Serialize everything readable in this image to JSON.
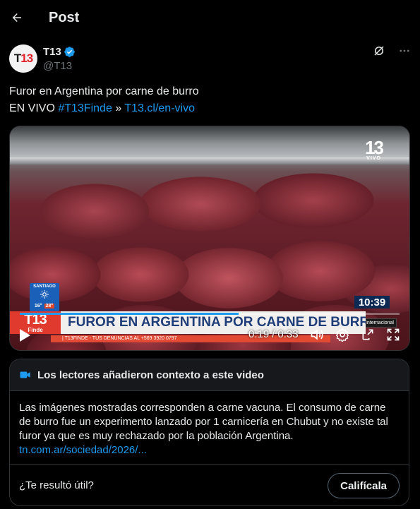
{
  "header": {
    "title": "Post"
  },
  "author": {
    "avatar_text_t": "T",
    "avatar_text_n": "13",
    "name": "T13",
    "handle": "@T13"
  },
  "post": {
    "line1": "Furor en Argentina por carne de burro",
    "live_prefix": "EN VIVO",
    "hashtag": "#T13Finde",
    "separator": "»",
    "url": "T13.cl/en-vivo"
  },
  "video": {
    "channel_logo": "13",
    "channel_logo_sub": "VIVO",
    "weather_city": "SANTIAGO",
    "temp_min": "16°",
    "temp_max": "28°",
    "clock": "10:39",
    "intl_tag": "Internacional",
    "brand_big": "T13",
    "brand_small": "Finde",
    "headline": "FUROR EN ARGENTINA POR CARNE DE BURRO",
    "ticker": "| T13FINDE - TUS DENUNCIAS AL +569 3920 0797",
    "current_time": "0:19",
    "time_separator": "/",
    "duration": "0:33",
    "progress_fraction": 0.576
  },
  "community_note": {
    "title": "Los lectores añadieron contexto a este video",
    "body": "Las imágenes mostradas corresponden a carne vacuna. El consumo de carne de burro fue un experimento lanzado por 1 carnicería en Chubut y no existe tal furor ya que es muy rechazado por la población Argentina.",
    "link": "tn.com.ar/sociedad/2026/...",
    "question": "¿Te resultó útil?",
    "rate_label": "Califícala"
  },
  "colors": {
    "accent": "#1d9bf0",
    "background": "#000000",
    "text": "#e7e9ea",
    "muted": "#71767b"
  }
}
